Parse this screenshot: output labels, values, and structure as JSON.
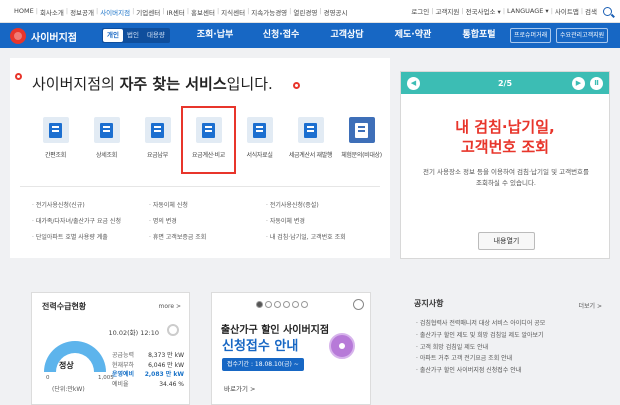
{
  "topbar": {
    "left_links": [
      "HOME",
      "회사소개",
      "정보공개",
      "사이버지점",
      "기업센터",
      "IR센터",
      "홍보센터",
      "지식센터",
      "지속가능경영",
      "열린경영",
      "경영공시"
    ],
    "active": "사이버지점",
    "right_links": [
      "로그인",
      "고객지원",
      "전국사업소 ▾",
      "LANGUAGE ▾",
      "사이트맵",
      "검색"
    ]
  },
  "nav": {
    "brand": "사이버지점",
    "segments": [
      "개인",
      "법인",
      "대용량"
    ],
    "menu": [
      "조회·납부",
      "신청·접수",
      "고객상담",
      "제도·약관",
      "통합포털"
    ],
    "buttons": [
      "프로슈머거래",
      "수요관리고객지원"
    ]
  },
  "main": {
    "headline_pre": "사이버지점의 ",
    "headline_bold": "자주 찾는 서비스",
    "headline_post": "입니다.",
    "icons": [
      "간편조회",
      "상세조회",
      "요금납부",
      "요금계산·비교",
      "서식자료실",
      "세금계산서 재발행",
      "체험문의(비대상)"
    ],
    "links": [
      "전기사용신청(신규)",
      "자동이체 신청",
      "전기사용신청(증설)",
      "대가족/다자녀/출산가구 요금 신청",
      "명의 변경",
      "자동이체 변경",
      "단일아파트 호별 사용량 계출",
      "휴면 고객보증금 조회",
      "내 검침·납기일, 고객번호 조회"
    ]
  },
  "side": {
    "counter": "2/5",
    "title_line1": "내 검침·납기일,",
    "title_line2": "고객번호 조회",
    "desc": "전기 사용장소 정보 등을 이용하여 검침·납기일 및 고객번호를 조회하실 수 있습니다.",
    "button": "내용열기"
  },
  "power": {
    "title": "전력수급현황",
    "more": "more >",
    "datetime": "10.02(화) 12:10",
    "gauge_status": "정상",
    "gauge_min": "0",
    "gauge_max": "1,005",
    "unit": "(단위:만kW)",
    "stats": [
      {
        "k": "공급능력",
        "v": "8,373 만 kW"
      },
      {
        "k": "현재부하",
        "v": "6,046 만 kW"
      },
      {
        "k": "운영예비",
        "v": "2,083 만 kW"
      },
      {
        "k": "예비율",
        "v": "34.46 %"
      }
    ]
  },
  "promo": {
    "line1": "출산가구 할인 사이버지점",
    "line2": "신청접수 안내",
    "period": "접수기간 : 18.08.10(금) ~",
    "more": "바로가기 >"
  },
  "notice": {
    "title": "공지사항",
    "more": "더보기 >",
    "items": [
      "검침협력사 전력매니저 대상 서비스 아이디어 공모",
      "출산가구 할인 제도 및 희망 검침일 제도 알아보기",
      "고객 희망 검침일 제도 안내",
      "아파트 거주 고객 전기요금 조회 안내",
      "출산가구 할인 사이버지점 신청접수 안내"
    ]
  }
}
